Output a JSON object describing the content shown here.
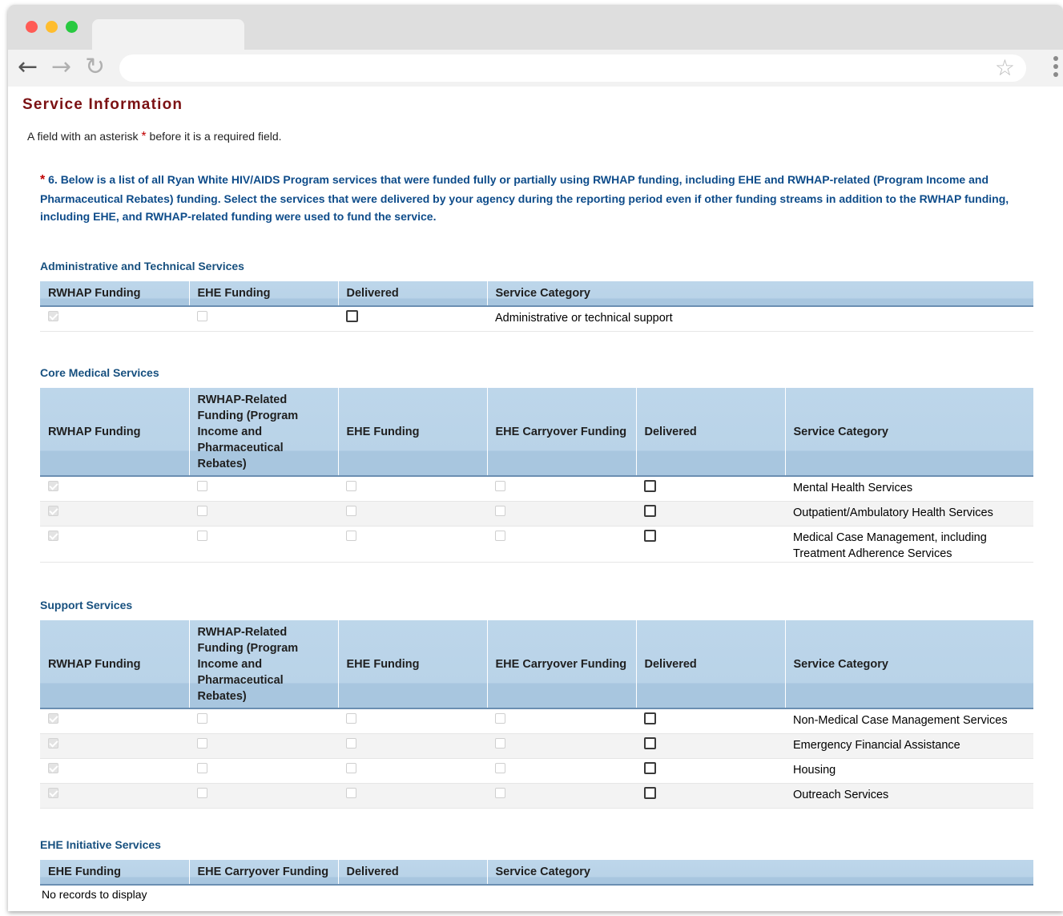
{
  "page": {
    "title": "Service Information",
    "required_note_before": "A field with an asterisk",
    "required_note_after": "before it is a required field.",
    "asterisk": "*",
    "question": "6. Below is a list of all Ryan White HIV/AIDS Program services that were funded fully or partially using RWHAP funding, including EHE and RWHAP-related (Program Income and Pharmaceutical Rebates) funding. Select the services that were delivered by your agency during the reporting period even if other funding streams in addition to the RWHAP funding, including EHE, and RWHAP-related funding were used to fund the service."
  },
  "admin": {
    "title": "Administrative and Technical Services",
    "headers": [
      "RWHAP Funding",
      "EHE Funding",
      "Delivered",
      "Service Category"
    ],
    "rows": [
      {
        "rwhap": true,
        "ehe": false,
        "delivered": false,
        "category": "Administrative or technical support"
      }
    ]
  },
  "core": {
    "title": "Core Medical Services",
    "headers": [
      "RWHAP Funding",
      "RWHAP-Related Funding (Program Income and Pharmaceutical Rebates)",
      "EHE Funding",
      "EHE Carryover Funding",
      "Delivered",
      "Service Category"
    ],
    "rows": [
      {
        "rwhap": true,
        "related": false,
        "ehe": false,
        "carryover": false,
        "delivered": false,
        "category": "Mental Health Services"
      },
      {
        "rwhap": true,
        "related": false,
        "ehe": false,
        "carryover": false,
        "delivered": false,
        "category": "Outpatient/Ambulatory Health Services"
      },
      {
        "rwhap": true,
        "related": false,
        "ehe": false,
        "carryover": false,
        "delivered": false,
        "category": "Medical Case Management, including Treatment Adherence Services"
      }
    ]
  },
  "support": {
    "title": "Support Services",
    "headers": [
      "RWHAP Funding",
      "RWHAP-Related Funding (Program Income and Pharmaceutical Rebates)",
      "EHE Funding",
      "EHE Carryover Funding",
      "Delivered",
      "Service Category"
    ],
    "rows": [
      {
        "rwhap": true,
        "related": false,
        "ehe": false,
        "carryover": false,
        "delivered": false,
        "category": "Non-Medical Case Management Services"
      },
      {
        "rwhap": true,
        "related": false,
        "ehe": false,
        "carryover": false,
        "delivered": false,
        "category": "Emergency Financial Assistance"
      },
      {
        "rwhap": true,
        "related": false,
        "ehe": false,
        "carryover": false,
        "delivered": false,
        "category": "Housing"
      },
      {
        "rwhap": true,
        "related": false,
        "ehe": false,
        "carryover": false,
        "delivered": false,
        "category": "Outreach Services"
      }
    ]
  },
  "ehe": {
    "title": "EHE Initiative Services",
    "headers": [
      "EHE Funding",
      "EHE Carryover Funding",
      "Delivered",
      "Service Category"
    ],
    "empty_message": "No records to display"
  },
  "browser": {
    "back_icon": "arrow-left-icon",
    "forward_icon": "arrow-right-icon",
    "reload_icon": "reload-icon",
    "bookmark_icon": "star-icon",
    "menu_icon": "kebab-menu-icon"
  },
  "colors": {
    "title": "#7b1113",
    "question": "#0e4c8a",
    "section_title": "#17507f",
    "header_bg": "#bdd6ea",
    "asterisk": "#c00000"
  }
}
